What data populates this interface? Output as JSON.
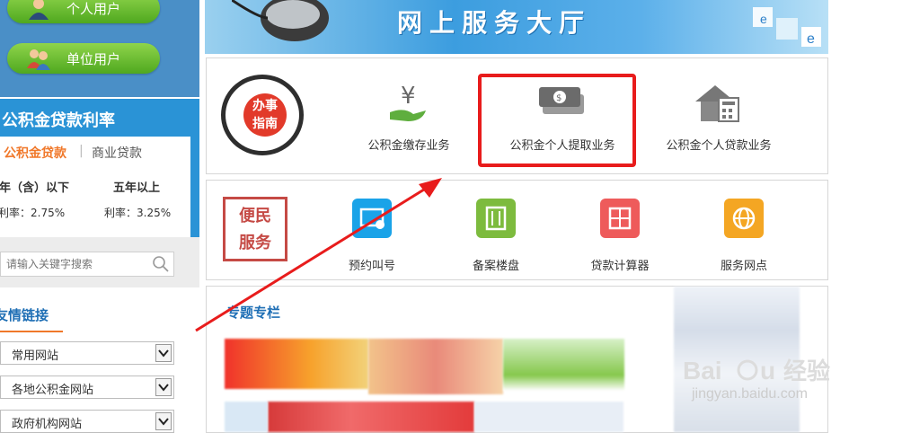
{
  "left": {
    "users": [
      {
        "label": "个人用户",
        "icon": "person-icon"
      },
      {
        "label": "单位用户",
        "icon": "group-icon"
      }
    ],
    "rates": {
      "title": "公积金贷款利率",
      "tab_active": "公积金贷款",
      "tab_separator": "|",
      "tab_inactive": "商业贷款",
      "col1_heading": "五年（含）以下",
      "col2_heading": "五年以上",
      "col1_value": "利率：2.75%",
      "col2_value": "利率：3.25%"
    },
    "search": {
      "placeholder": "请输入关键字搜索"
    },
    "links": {
      "title": "友情链接",
      "selects": [
        "常用网站",
        "各地公积金网站",
        "政府机构网站"
      ]
    }
  },
  "banner": {
    "title": "网上服务大厅"
  },
  "guide": {
    "seal_text": [
      "办事",
      "指南"
    ],
    "services": [
      {
        "label": "公积金缴存业务",
        "icon": "yen-hand-icon"
      },
      {
        "label": "公积金个人提取业务",
        "icon": "cash-stack-icon"
      },
      {
        "label": "公积金个人贷款业务",
        "icon": "house-calculator-icon"
      }
    ]
  },
  "convenience": {
    "seal_text": [
      "便民",
      "服务"
    ],
    "items": [
      {
        "label": "预约叫号",
        "icon": "appointment-icon",
        "color": "#1aa3e8"
      },
      {
        "label": "备案楼盘",
        "icon": "building-icon",
        "color": "#7dbb3e"
      },
      {
        "label": "贷款计算器",
        "icon": "calculator-icon",
        "color": "#ee5b5b"
      },
      {
        "label": "服务网点",
        "icon": "globe-icon",
        "color": "#f4a623"
      }
    ]
  },
  "topics": {
    "title": "专题专栏"
  },
  "watermark": {
    "text": "jingyan.baidu.com"
  },
  "colors": {
    "highlight": "#e81c1c",
    "accent_orange": "#f0782a",
    "link_blue": "#1f6fb5"
  }
}
